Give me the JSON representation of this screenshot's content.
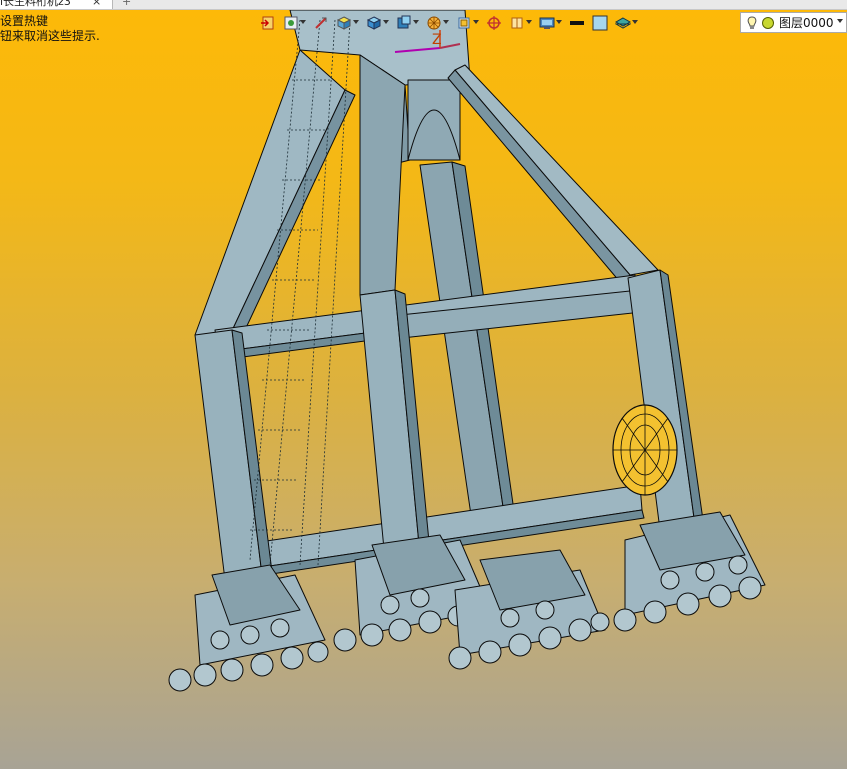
{
  "tab": {
    "title": "i长生料桁机z3",
    "close_glyph": "×",
    "add_glyph": "+"
  },
  "hint": {
    "line1": "设置热键",
    "line2": "钮来取消这些提示."
  },
  "toolbar": {
    "items": [
      {
        "name": "exit-sketch-icon",
        "dropdown": false
      },
      {
        "name": "view-settings-icon",
        "dropdown": true
      },
      {
        "name": "render-style-icon",
        "dropdown": false
      },
      {
        "name": "shaded-cube-icon",
        "dropdown": true
      },
      {
        "name": "cube-view-icon",
        "dropdown": true
      },
      {
        "name": "section-view-icon",
        "dropdown": true
      },
      {
        "name": "zoom-window-icon",
        "dropdown": true
      },
      {
        "name": "coordinate-icon",
        "dropdown": true
      },
      {
        "name": "grid-icon",
        "dropdown": false
      },
      {
        "name": "dimension-icon",
        "dropdown": true
      },
      {
        "name": "display-icon",
        "dropdown": true
      },
      {
        "name": "line-color-icon",
        "dropdown": false
      },
      {
        "name": "fill-color-icon",
        "dropdown": false
      },
      {
        "name": "layers-icon",
        "dropdown": true
      }
    ]
  },
  "layer": {
    "name": "图层0000"
  },
  "axis": {
    "z_label": "Z"
  },
  "colors": {
    "bg_top": "#fdb908",
    "bg_bottom": "#a8a395",
    "steel": "#8fa9b4",
    "steel_dark": "#5f7d8a",
    "steel_light": "#a6bec8",
    "outline": "#0b0b0b"
  }
}
